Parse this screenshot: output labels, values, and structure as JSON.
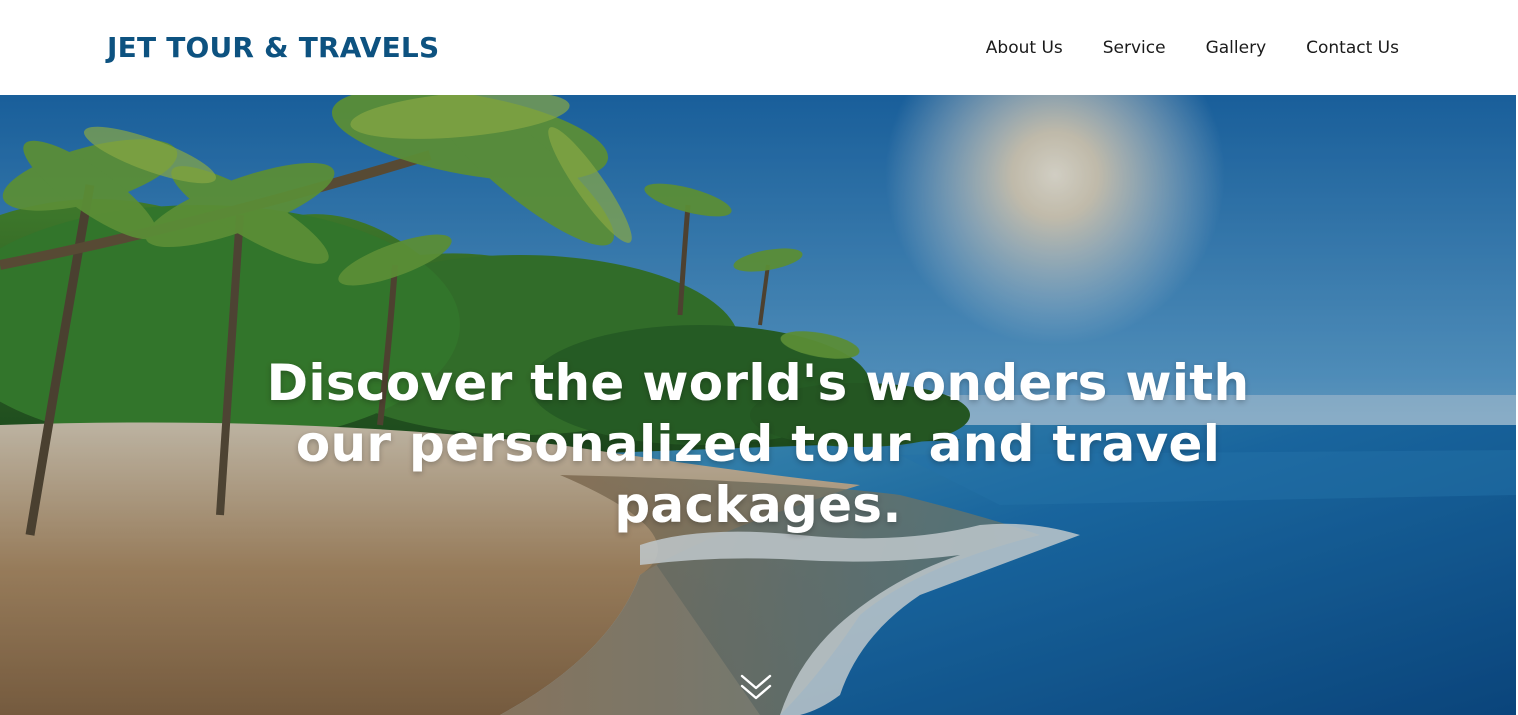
{
  "brand": {
    "name": "JET TOUR & TRAVELS",
    "color": "#0d5280"
  },
  "nav": {
    "items": [
      {
        "label": "About Us"
      },
      {
        "label": "Service"
      },
      {
        "label": "Gallery"
      },
      {
        "label": "Contact Us"
      }
    ]
  },
  "hero": {
    "headline": "Discover the world's wonders with our personalized tour and travel packages.",
    "background_image": "tropical-beach-palm-trees",
    "scroll_icon": "double-chevron-down-icon"
  }
}
